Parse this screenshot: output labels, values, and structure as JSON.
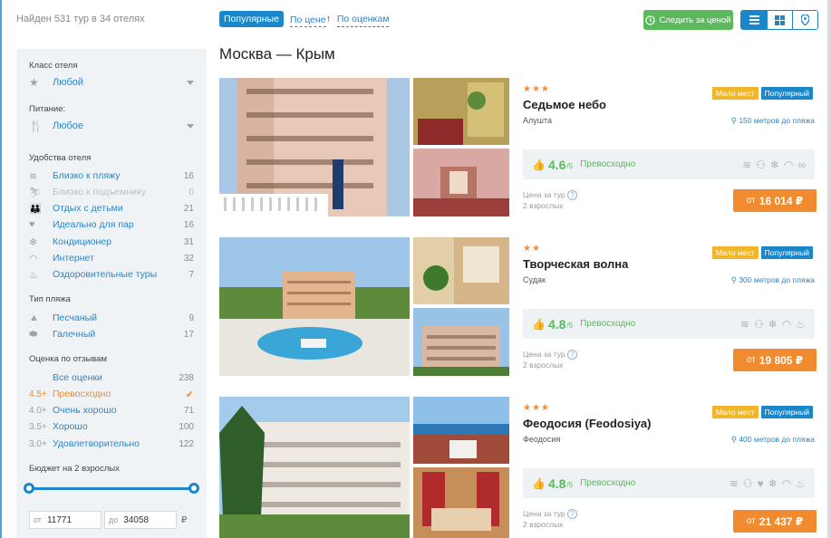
{
  "header": {
    "found_text": "Найден 531 тур в 34 отелях",
    "sort_tabs": [
      {
        "label": "Популярные",
        "active": true
      },
      {
        "label": "По цене",
        "arrow": "↑"
      },
      {
        "label": "По оценкам"
      }
    ],
    "track_price_label": "Следить за ценой",
    "view_icons": [
      "list-icon",
      "grid-icon",
      "map-pin-icon"
    ]
  },
  "sidebar": {
    "hotel_class": {
      "title": "Класс отеля",
      "value": "Любой"
    },
    "meals": {
      "title": "Питание:",
      "value": "Любое"
    },
    "amenities": {
      "title": "Удобства отеля",
      "items": [
        {
          "label": "Близко к пляжу",
          "count": "16"
        },
        {
          "label": "Близко к подъемнику",
          "count": "0",
          "disabled": true
        },
        {
          "label": "Отдых с детьми",
          "count": "21"
        },
        {
          "label": "Идеально для пар",
          "count": "16"
        },
        {
          "label": "Кондиционер",
          "count": "31"
        },
        {
          "label": "Интернет",
          "count": "32"
        },
        {
          "label": "Оздоровительные туры",
          "count": "7"
        }
      ]
    },
    "beach": {
      "title": "Тип пляжа",
      "items": [
        {
          "label": "Песчаный",
          "count": "9"
        },
        {
          "label": "Галечный",
          "count": "17"
        }
      ]
    },
    "reviews": {
      "title": "Оценка по отзывам",
      "items": [
        {
          "score": "",
          "label": "Все оценки",
          "count": "238"
        },
        {
          "score": "4.5+",
          "label": "Превосходно",
          "count": "",
          "selected": true
        },
        {
          "score": "4.0+",
          "label": "Очень хорошо",
          "count": "71"
        },
        {
          "score": "3.5+",
          "label": "Хорошо",
          "count": "100"
        },
        {
          "score": "3.0+",
          "label": "Удовлетворительно",
          "count": "122"
        }
      ]
    },
    "budget": {
      "title": "Бюджет на 2 взрослых",
      "from_prefix": "от",
      "from_value": "11771",
      "to_prefix": "до",
      "to_value": "34058",
      "currency": "₽"
    }
  },
  "main": {
    "title": "Москва — Крым",
    "hotels": [
      {
        "stars": "★★★",
        "name": "Седьмое небо",
        "city": "Алушта",
        "badges": [
          "Мало мест",
          "Популярный"
        ],
        "distance": "150 метров до пляжа",
        "rating": "4.6",
        "rating_scale": "/5",
        "rating_word": "Превосходно",
        "price_label": "Цена за тур",
        "guests": "2 взрослых",
        "price_prefix": "от",
        "price": "16 014 ₽"
      },
      {
        "stars": "★★",
        "name": "Творческая волна",
        "city": "Судак",
        "badges": [
          "Мало мест",
          "Популярный"
        ],
        "distance": "300 метров до пляжа",
        "rating": "4.8",
        "rating_scale": "/5",
        "rating_word": "Превосходно",
        "price_label": "Цена за тур",
        "guests": "2 взрослых",
        "price_prefix": "от",
        "price": "19 805 ₽"
      },
      {
        "stars": "★★★",
        "name": "Феодосия (Feodosiya)",
        "city": "Феодосия",
        "badges": [
          "Мало мест",
          "Популярный"
        ],
        "distance": "400 метров до пляжа",
        "rating": "4.8",
        "rating_scale": "/5",
        "rating_word": "Превосходно",
        "price_label": "Цена за тур",
        "guests": "2 взрослых",
        "price_prefix": "от",
        "price": "21 437 ₽"
      }
    ]
  }
}
